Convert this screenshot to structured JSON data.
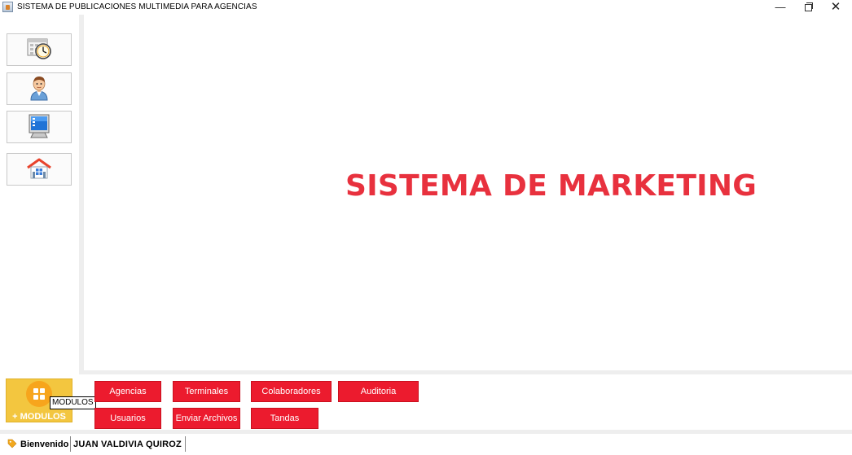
{
  "window": {
    "title": "SISTEMA DE PUBLICACIONES MULTIMEDIA PARA AGENCIAS",
    "controls": {
      "minimize": "—",
      "close": "✕"
    }
  },
  "sidebar": {
    "buttons": [
      {
        "icon": "calendar-clock-icon"
      },
      {
        "icon": "user-avatar-icon"
      },
      {
        "icon": "monitor-icon"
      },
      {
        "icon": "house-icon"
      }
    ]
  },
  "main": {
    "title": "SISTEMA DE MARKETING",
    "title_color": "#e8313e"
  },
  "modulos": {
    "label": "+ MODULOS",
    "tooltip": "MODULOS",
    "icon": "grid-icon",
    "color": "#f3c63f"
  },
  "module_buttons": {
    "agencias": "Agencias",
    "terminales": "Terminales",
    "colaboradores": "Colaboradores",
    "auditoria": "Auditoria",
    "usuarios": "Usuarios",
    "enviar_archivos": "Enviar Archivos",
    "tandas": "Tandas",
    "color": "#ec1b2e"
  },
  "status": {
    "welcome": "Bienvenido",
    "user": "JUAN VALDIVIA QUIROZ",
    "icon": "tag-icon"
  }
}
